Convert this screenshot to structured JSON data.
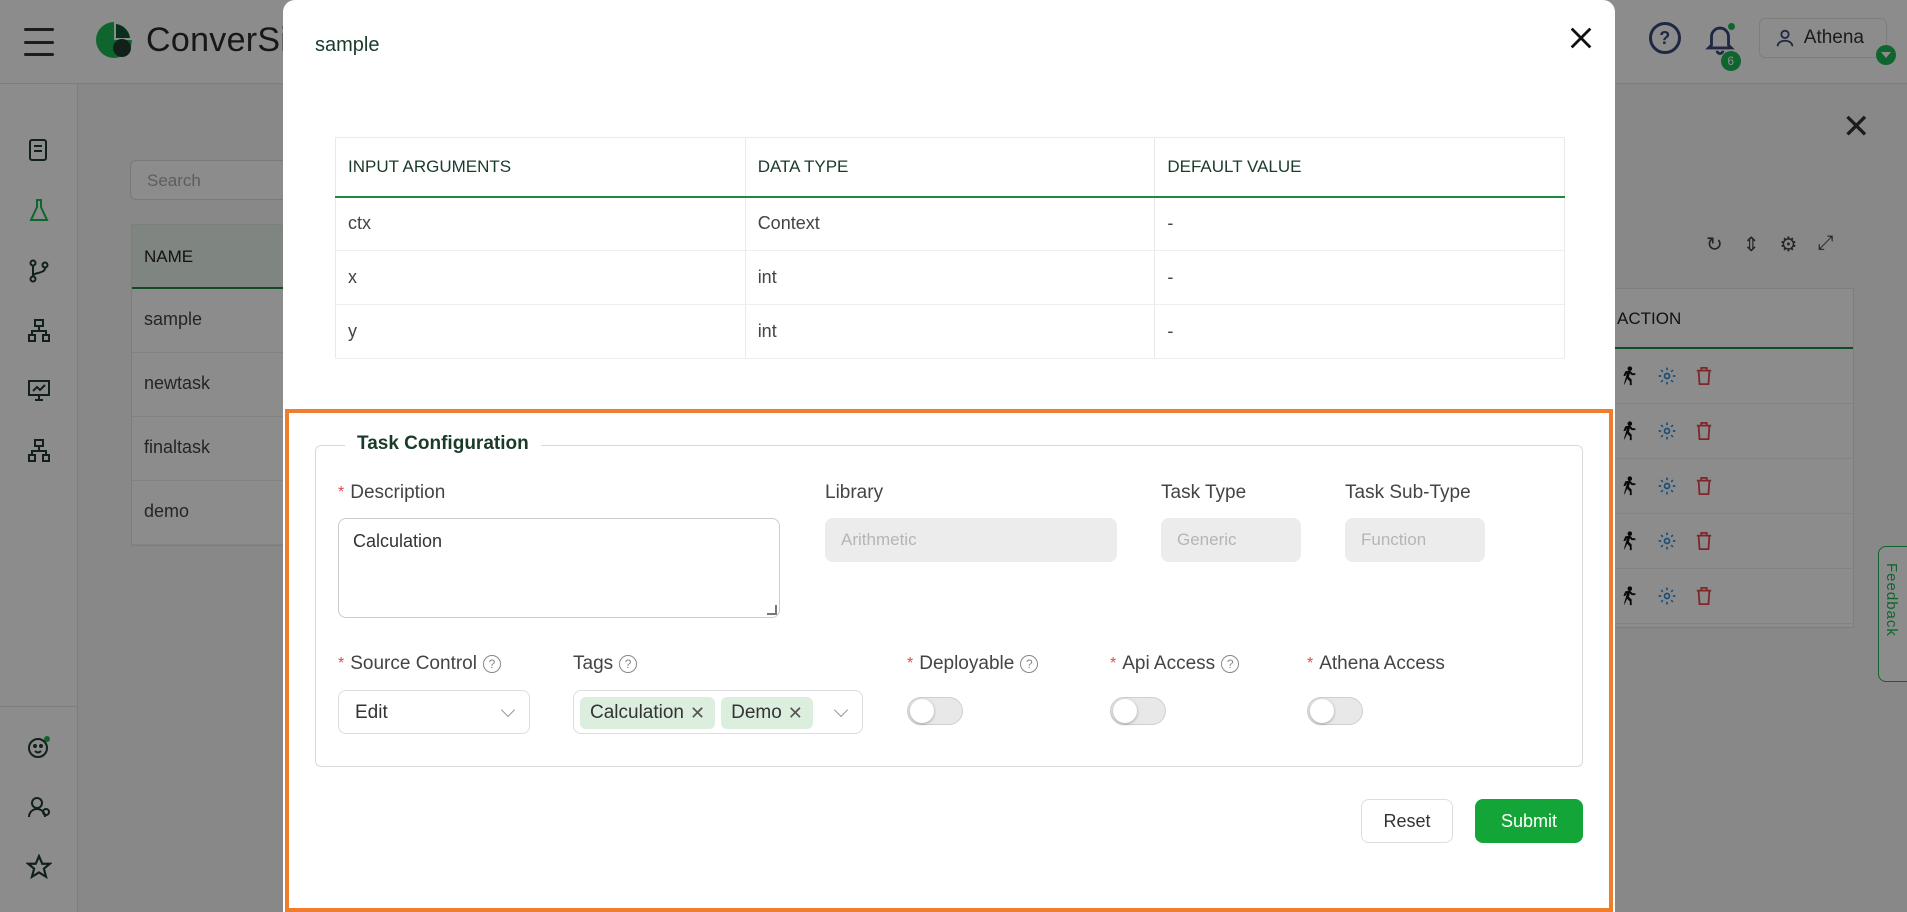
{
  "app": {
    "brand": "ConverSight",
    "user_name": "Athena",
    "notification_count": "6"
  },
  "background": {
    "search_placeholder": "Search",
    "table_header": "NAME",
    "rows": [
      "sample",
      "newtask",
      "finaltask",
      "demo"
    ],
    "action_header": "ACTION",
    "feedback_label": "Feedback"
  },
  "modal": {
    "title": "sample",
    "args_table": {
      "headers": [
        "INPUT ARGUMENTS",
        "DATA TYPE",
        "DEFAULT VALUE"
      ],
      "rows": [
        [
          "ctx",
          "Context",
          "-"
        ],
        [
          "x",
          "int",
          "-"
        ],
        [
          "y",
          "int",
          "-"
        ]
      ]
    },
    "task_config": {
      "legend": "Task Configuration",
      "description_label": "Description",
      "description_value": "Calculation",
      "library_label": "Library",
      "library_value": "Arithmetic",
      "task_type_label": "Task Type",
      "task_type_value": "Generic",
      "task_subtype_label": "Task Sub-Type",
      "task_subtype_value": "Function",
      "source_control_label": "Source Control",
      "source_control_value": "Edit",
      "tags_label": "Tags",
      "tags": [
        "Calculation",
        "Demo"
      ],
      "deployable_label": "Deployable",
      "api_access_label": "Api Access",
      "athena_access_label": "Athena Access",
      "required_mark": "*"
    },
    "buttons": {
      "reset": "Reset",
      "submit": "Submit"
    }
  },
  "colors": {
    "accent": "#13a538",
    "highlight": "#f07d2b",
    "table_rule": "#1d8a3c"
  }
}
